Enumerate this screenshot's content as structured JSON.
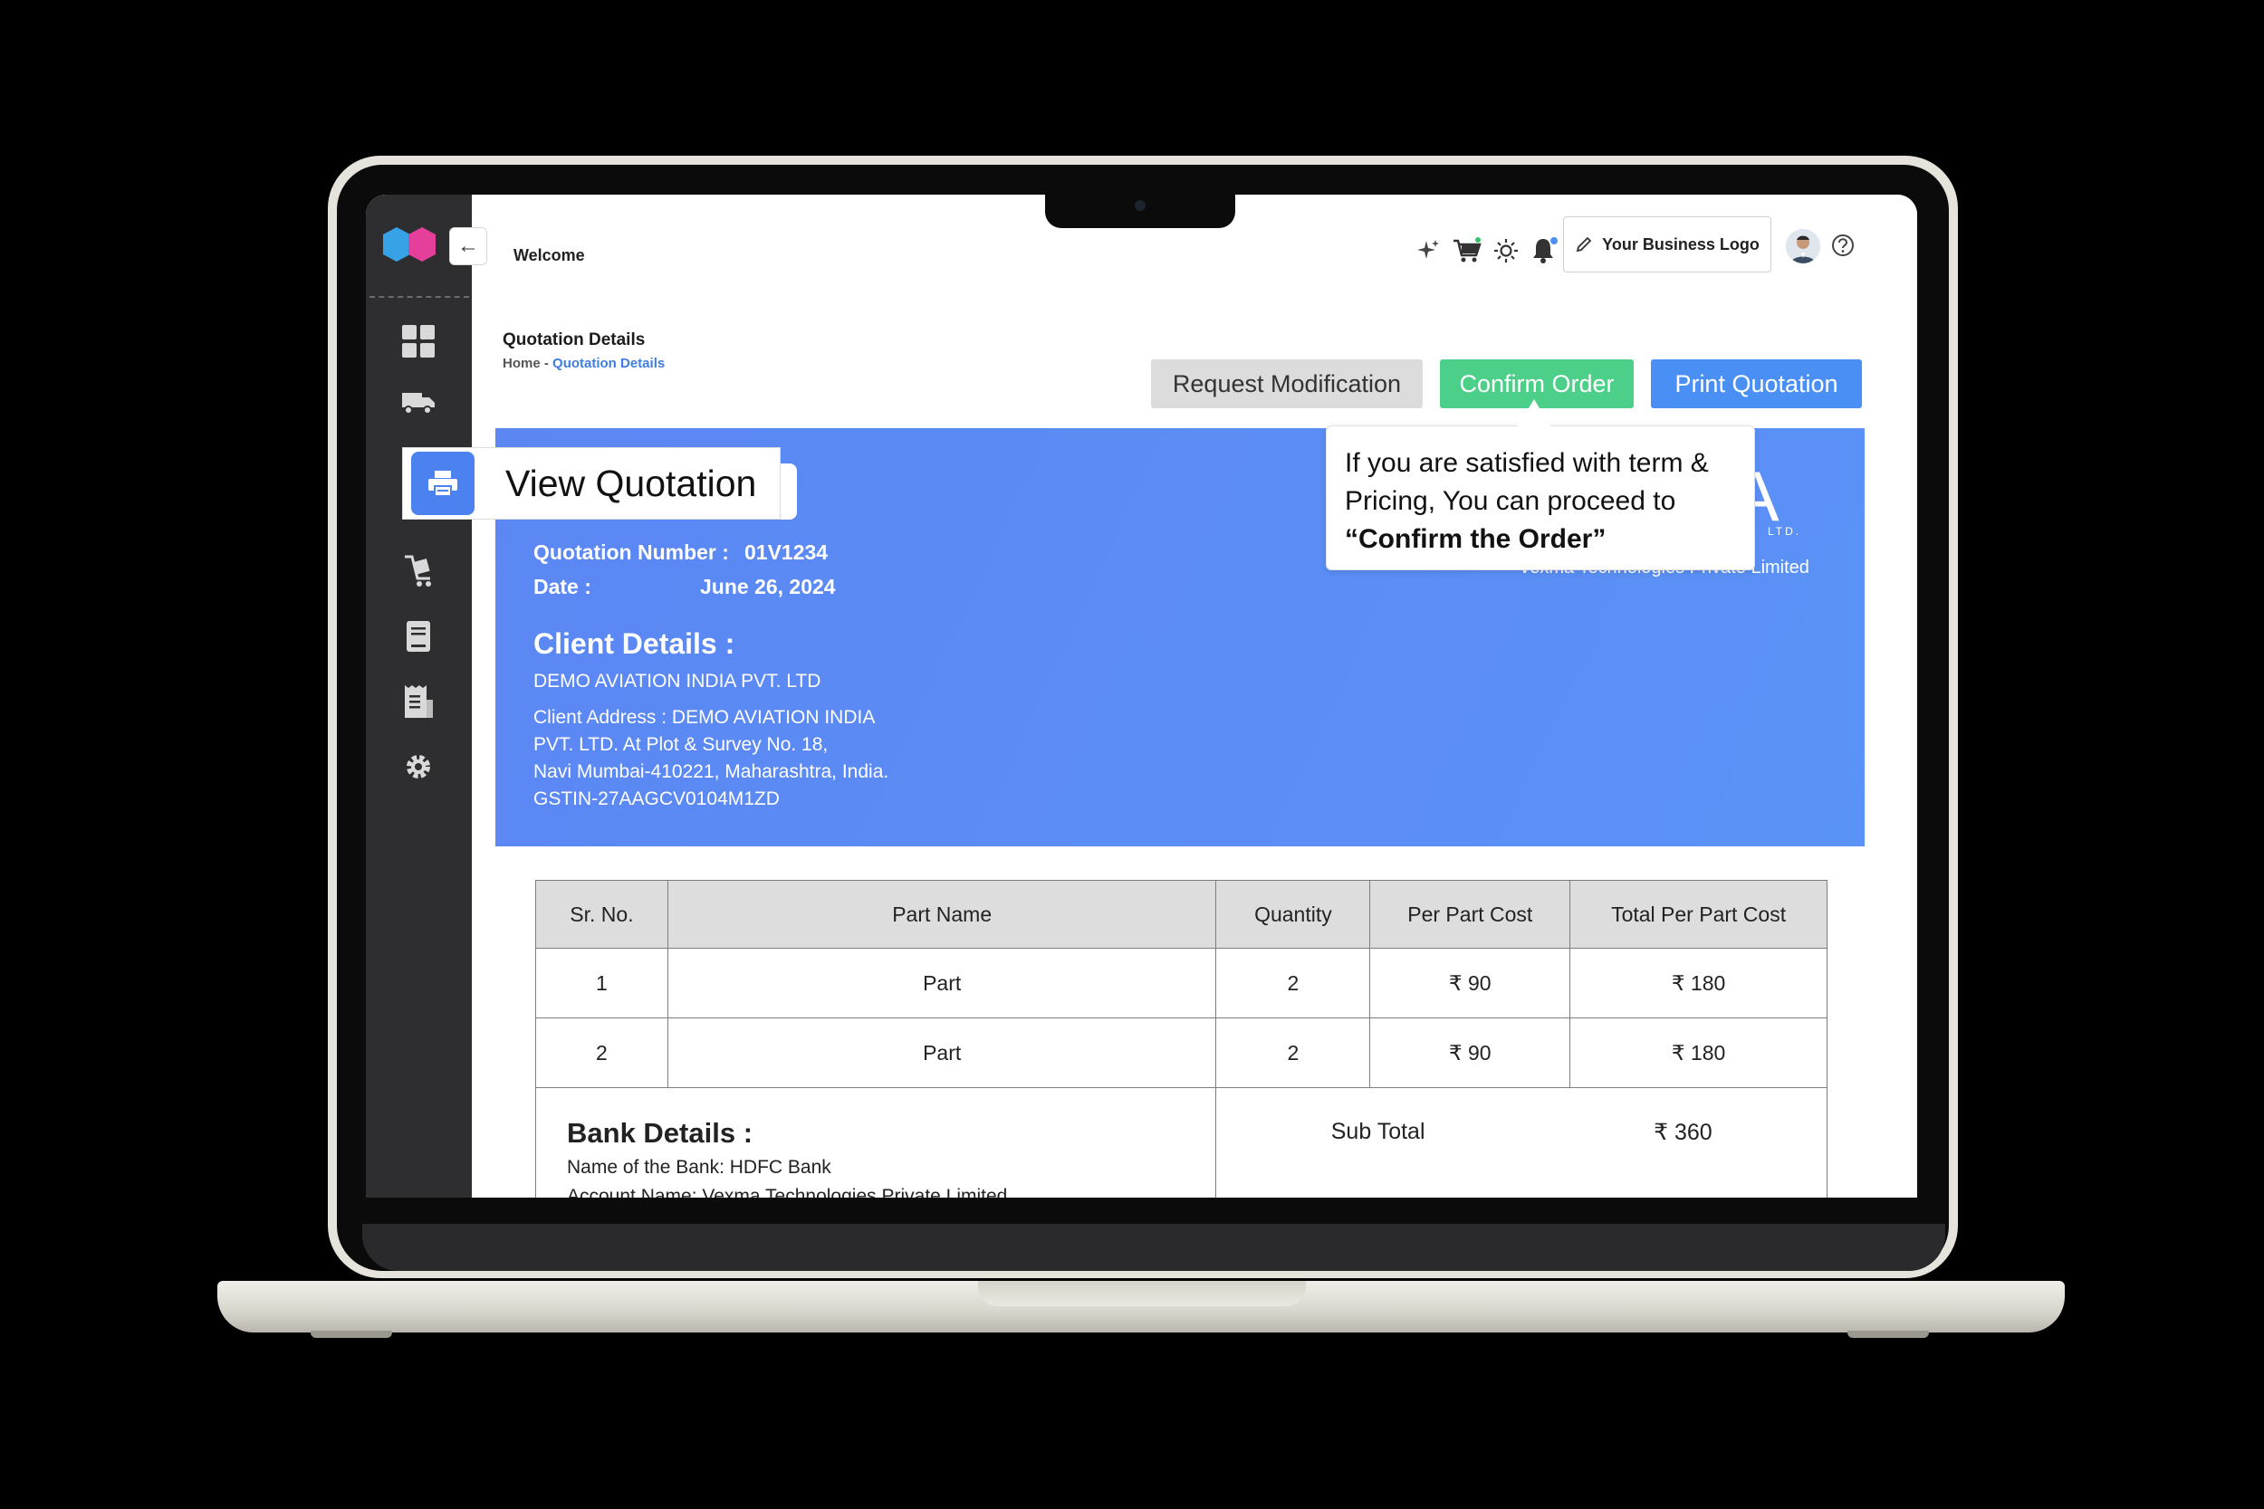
{
  "topbar": {
    "welcome": "Welcome",
    "logo_button_label": "Your Business Logo"
  },
  "page": {
    "title": "Quotation Details",
    "breadcrumb_home": "Home",
    "breadcrumb_sep": " - ",
    "breadcrumb_current": "Quotation Details"
  },
  "actions": {
    "request_modification": "Request Modification",
    "confirm_order": "Confirm Order",
    "print_quotation": "Print Quotation"
  },
  "nav_callout": {
    "label": "View Quotation"
  },
  "tooltip": {
    "line1": "If you are satisfied with term &",
    "line2": "Pricing, You can proceed to",
    "line3": "“Confirm the Order”"
  },
  "quotation": {
    "number_label": "Quotation Number :",
    "number_value": "01V1234",
    "date_label": "Date :",
    "date_value": "June 26, 2024",
    "brand_mark": "IA",
    "brand_ltd": "LTD.",
    "brand_sub": "Vexma Technologies Private Limited"
  },
  "client": {
    "title": "Client Details :",
    "name": "DEMO AVIATION INDIA PVT. LTD",
    "address_line1": "Client Address : DEMO AVIATION INDIA",
    "address_line2": "PVT. LTD. At Plot & Survey No. 18,",
    "address_line3": "Navi Mumbai-410221, Maharashtra, India.",
    "address_line4": "GSTIN-27AAGCV0104M1ZD"
  },
  "table": {
    "headers": [
      "Sr. No.",
      "Part Name",
      "Quantity",
      "Per Part Cost",
      "Total Per Part Cost"
    ],
    "rows": [
      [
        "1",
        "Part",
        "2",
        "₹ 90",
        "₹ 180"
      ],
      [
        "2",
        "Part",
        "2",
        "₹ 90",
        "₹ 180"
      ]
    ]
  },
  "bank": {
    "title": "Bank Details :",
    "bank_name": "Name of the Bank: HDFC Bank",
    "account_name": "Account Name: Vexma Technologies Private  Limited"
  },
  "totals": {
    "subtotal_label": "Sub Total",
    "subtotal_value": "₹ 360"
  },
  "colors": {
    "accent_blue": "#4a90f4",
    "confirm_green": "#4ccf89",
    "panel_blue": "#5b87f3",
    "sidebar": "#2e2e30"
  },
  "icons": {
    "sidebar": [
      "dashboard-icon",
      "truck-icon",
      "quotation-icon",
      "cart-hand-icon",
      "book-icon",
      "invoice-icon",
      "gear-icon"
    ],
    "topbar": [
      "sparkle-icon",
      "cart-icon",
      "sun-icon",
      "bell-icon",
      "pencil-icon",
      "avatar",
      "help-icon"
    ]
  }
}
